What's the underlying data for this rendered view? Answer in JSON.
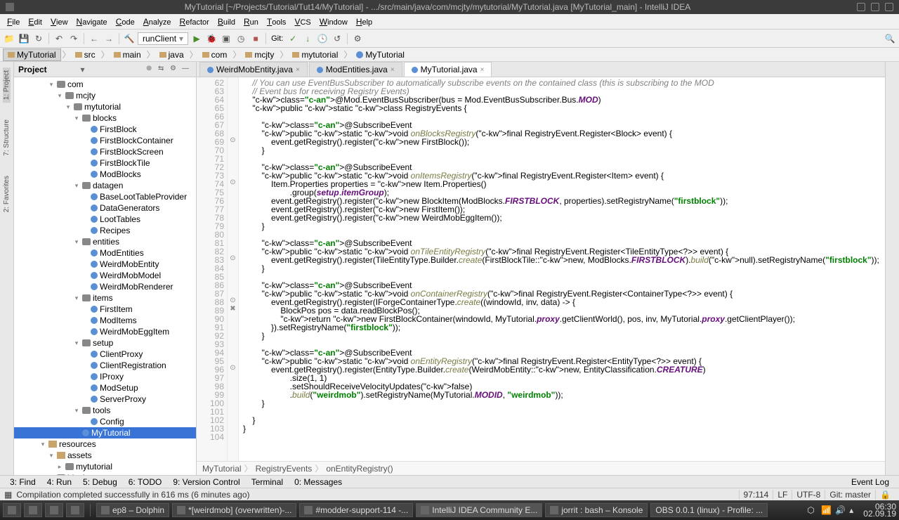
{
  "window": {
    "title": "MyTutorial [~/Projects/Tutorial/Tut14/MyTutorial] - .../src/main/java/com/mcjty/mytutorial/MyTutorial.java [MyTutorial_main] - IntelliJ IDEA"
  },
  "menu": [
    "File",
    "Edit",
    "View",
    "Navigate",
    "Code",
    "Analyze",
    "Refactor",
    "Build",
    "Run",
    "Tools",
    "VCS",
    "Window",
    "Help"
  ],
  "toolbar": {
    "run_config": "runClient",
    "git_label": "Git:"
  },
  "breadcrumb": [
    "MyTutorial",
    "src",
    "main",
    "java",
    "com",
    "mcjty",
    "mytutorial",
    "MyTutorial"
  ],
  "project": {
    "title": "Project",
    "tree": [
      {
        "d": 4,
        "t": "toggle-open",
        "icon": "pkg",
        "label": "com"
      },
      {
        "d": 5,
        "t": "toggle-open",
        "icon": "pkg",
        "label": "mcjty"
      },
      {
        "d": 6,
        "t": "toggle-open",
        "icon": "pkg",
        "label": "mytutorial"
      },
      {
        "d": 7,
        "t": "toggle-open",
        "icon": "pkg",
        "label": "blocks"
      },
      {
        "d": 8,
        "t": "leaf",
        "icon": "class",
        "label": "FirstBlock"
      },
      {
        "d": 8,
        "t": "leaf",
        "icon": "class",
        "label": "FirstBlockContainer"
      },
      {
        "d": 8,
        "t": "leaf",
        "icon": "class",
        "label": "FirstBlockScreen"
      },
      {
        "d": 8,
        "t": "leaf",
        "icon": "class",
        "label": "FirstBlockTile"
      },
      {
        "d": 8,
        "t": "leaf",
        "icon": "class",
        "label": "ModBlocks"
      },
      {
        "d": 7,
        "t": "toggle-open",
        "icon": "pkg",
        "label": "datagen"
      },
      {
        "d": 8,
        "t": "leaf",
        "icon": "class",
        "label": "BaseLootTableProvider"
      },
      {
        "d": 8,
        "t": "leaf",
        "icon": "class",
        "label": "DataGenerators"
      },
      {
        "d": 8,
        "t": "leaf",
        "icon": "class",
        "label": "LootTables"
      },
      {
        "d": 8,
        "t": "leaf",
        "icon": "class",
        "label": "Recipes"
      },
      {
        "d": 7,
        "t": "toggle-open",
        "icon": "pkg",
        "label": "entities"
      },
      {
        "d": 8,
        "t": "leaf",
        "icon": "class",
        "label": "ModEntities"
      },
      {
        "d": 8,
        "t": "leaf",
        "icon": "class",
        "label": "WeirdMobEntity"
      },
      {
        "d": 8,
        "t": "leaf",
        "icon": "class",
        "label": "WeirdMobModel"
      },
      {
        "d": 8,
        "t": "leaf",
        "icon": "class",
        "label": "WeirdMobRenderer"
      },
      {
        "d": 7,
        "t": "toggle-open",
        "icon": "pkg",
        "label": "items"
      },
      {
        "d": 8,
        "t": "leaf",
        "icon": "class",
        "label": "FirstItem"
      },
      {
        "d": 8,
        "t": "leaf",
        "icon": "class",
        "label": "ModItems"
      },
      {
        "d": 8,
        "t": "leaf",
        "icon": "class",
        "label": "WeirdMobEggItem"
      },
      {
        "d": 7,
        "t": "toggle-open",
        "icon": "pkg",
        "label": "setup"
      },
      {
        "d": 8,
        "t": "leaf",
        "icon": "class",
        "label": "ClientProxy"
      },
      {
        "d": 8,
        "t": "leaf",
        "icon": "class",
        "label": "ClientRegistration"
      },
      {
        "d": 8,
        "t": "leaf",
        "icon": "class",
        "label": "IProxy"
      },
      {
        "d": 8,
        "t": "leaf",
        "icon": "class",
        "label": "ModSetup"
      },
      {
        "d": 8,
        "t": "leaf",
        "icon": "class",
        "label": "ServerProxy"
      },
      {
        "d": 7,
        "t": "toggle-open",
        "icon": "pkg",
        "label": "tools"
      },
      {
        "d": 8,
        "t": "leaf",
        "icon": "class",
        "label": "Config"
      },
      {
        "d": 7,
        "t": "leaf",
        "icon": "class",
        "label": "MyTutorial",
        "sel": true
      },
      {
        "d": 3,
        "t": "toggle-open",
        "icon": "folder",
        "label": "resources"
      },
      {
        "d": 4,
        "t": "toggle-open",
        "icon": "folder",
        "label": "assets"
      },
      {
        "d": 5,
        "t": "toggle-closed",
        "icon": "pkg",
        "label": "mytutorial"
      },
      {
        "d": 4,
        "t": "toggle-closed",
        "icon": "pkg",
        "label": "blockstates"
      }
    ]
  },
  "editor": {
    "tabs": [
      {
        "label": "WeirdMobEntity.java",
        "active": false
      },
      {
        "label": "ModEntities.java",
        "active": false
      },
      {
        "label": "MyTutorial.java",
        "active": true
      }
    ],
    "first_line": 62,
    "lines": [
      "    // You can use EventBusSubscriber to automatically subscribe events on the contained class (this is subscribing to the MOD",
      "    // Event bus for receiving Registry Events)",
      "    @Mod.EventBusSubscriber(bus = Mod.EventBusSubscriber.Bus.MOD)",
      "    public static class RegistryEvents {",
      "",
      "        @SubscribeEvent",
      "        public static void onBlocksRegistry(final RegistryEvent.Register<Block> event) {",
      "            event.getRegistry().register(new FirstBlock());",
      "        }",
      "",
      "        @SubscribeEvent",
      "        public static void onItemsRegistry(final RegistryEvent.Register<Item> event) {",
      "            Item.Properties properties = new Item.Properties()",
      "                    .group(setup.itemGroup);",
      "            event.getRegistry().register(new BlockItem(ModBlocks.FIRSTBLOCK, properties).setRegistryName(\"firstblock\"));",
      "            event.getRegistry().register(new FirstItem());",
      "            event.getRegistry().register(new WeirdMobEggItem());",
      "        }",
      "",
      "        @SubscribeEvent",
      "        public static void onTileEntityRegistry(final RegistryEvent.Register<TileEntityType<?>> event) {",
      "            event.getRegistry().register(TileEntityType.Builder.create(FirstBlockTile::new, ModBlocks.FIRSTBLOCK).build(null).setRegistryName(\"firstblock\"));",
      "        }",
      "",
      "        @SubscribeEvent",
      "        public static void onContainerRegistry(final RegistryEvent.Register<ContainerType<?>> event) {",
      "            event.getRegistry().register(IForgeContainerType.create((windowId, inv, data) -> {",
      "                BlockPos pos = data.readBlockPos();",
      "                return new FirstBlockContainer(windowId, MyTutorial.proxy.getClientWorld(), pos, inv, MyTutorial.proxy.getClientPlayer());",
      "            }).setRegistryName(\"firstblock\"));",
      "        }",
      "",
      "        @SubscribeEvent",
      "        public static void onEntityRegistry(final RegistryEvent.Register<EntityType<?>> event) {",
      "            event.getRegistry().register(EntityType.Builder.create(WeirdMobEntity::new, EntityClassification.CREATURE)",
      "                    .size(1, 1)",
      "                    .setShouldReceiveVelocityUpdates(false)",
      "                    .build(\"weirdmob\").setRegistryName(MyTutorial.MODID, \"weirdmob\"));",
      "        }",
      "",
      "    }",
      "}",
      ""
    ],
    "marks": {
      "69": "⊙",
      "74": "⊙",
      "83": "⊙",
      "88": "⊙",
      "89": "✖",
      "96": "⊙"
    },
    "breadcrumb": [
      "MyTutorial",
      "RegistryEvents",
      "onEntityRegistry()"
    ]
  },
  "bottom_tools": {
    "left": [
      "3: Find",
      "4: Run",
      "5: Debug",
      "6: TODO",
      "9: Version Control",
      "Terminal",
      "0: Messages"
    ],
    "right": "Event Log"
  },
  "status": {
    "msg": "Compilation completed successfully in 616 ms (6 minutes ago)",
    "pos": "97:114",
    "sep": "LF",
    "enc": "UTF-8",
    "git": "Git: master",
    "lock": "🔒"
  },
  "taskbar": {
    "items": [
      {
        "label": "ep8 – Dolphin"
      },
      {
        "label": "*[weirdmob] (overwritten)-..."
      },
      {
        "label": "#modder-support-114 -..."
      },
      {
        "label": "IntelliJ IDEA Community E...",
        "active": true
      },
      {
        "label": "jorrit : bash – Konsole"
      }
    ],
    "obs": "OBS 0.0.1 (linux) - Profile: ...",
    "clock_time": "06:30",
    "clock_date": "02.09.19"
  }
}
